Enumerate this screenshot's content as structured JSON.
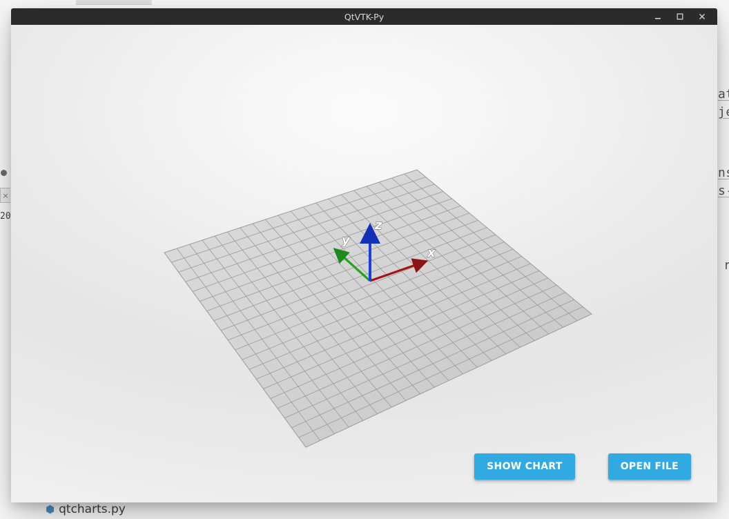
{
  "window": {
    "title": "QtVTK-Py"
  },
  "buttons": {
    "show_chart": "SHOW CHART",
    "open_file": "OPEN FILE"
  },
  "axes": {
    "x_label": "x",
    "y_label": "y",
    "z_label": "z",
    "x_color": "#b81a1a",
    "y_color": "#2aa827",
    "z_color": "#1a3fe0"
  },
  "background": {
    "file_label": "qtcharts.py",
    "date_fragment": "20",
    "text_fragments": [
      "at",
      "je",
      "ns",
      "s-",
      "r"
    ]
  }
}
